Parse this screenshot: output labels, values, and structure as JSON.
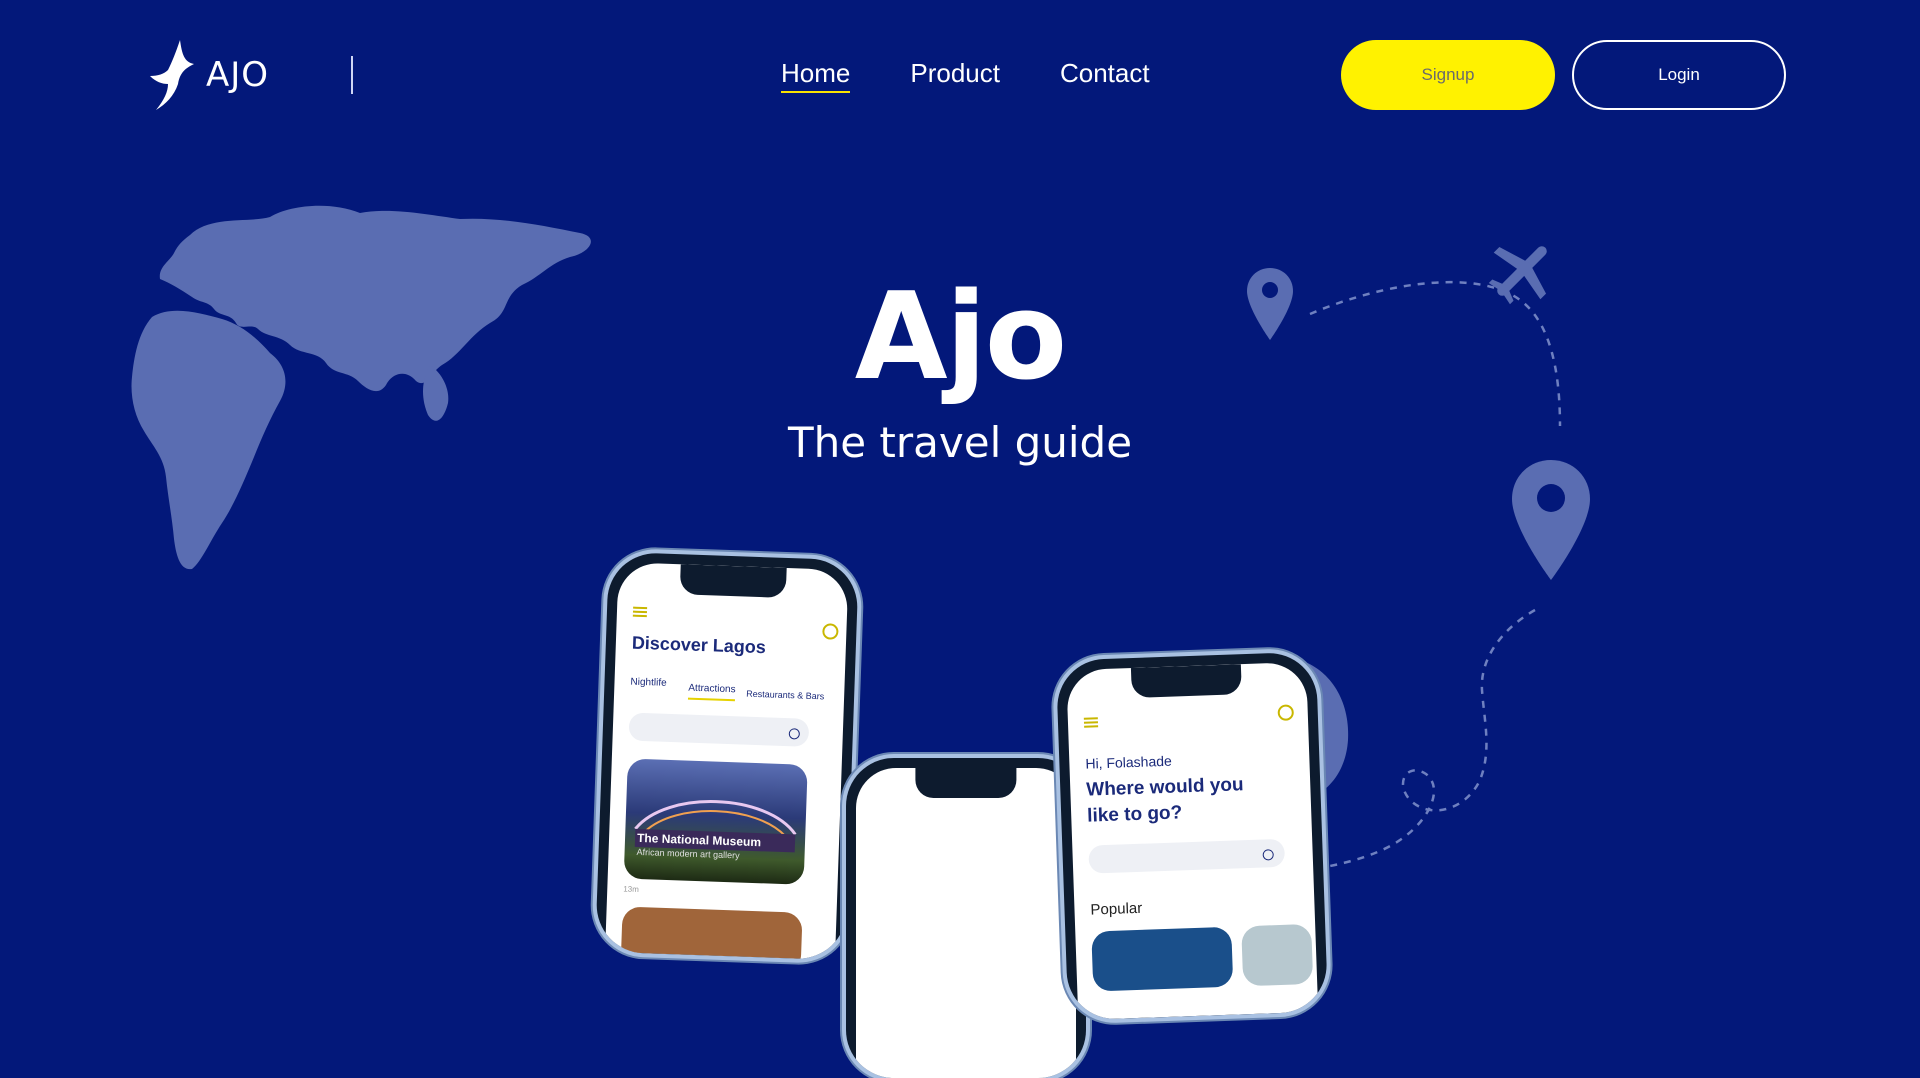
{
  "brand": {
    "name": "AJO"
  },
  "nav": {
    "home": "Home",
    "product": "Product",
    "contact": "Contact"
  },
  "actions": {
    "signup": "Signup",
    "login": "Login"
  },
  "hero": {
    "title": "Ajo",
    "subtitle": "The travel guide"
  },
  "phone_left": {
    "heading": "Discover Lagos",
    "tabs": [
      "Nightlife",
      "Attractions",
      "Restaurants & Bars"
    ],
    "card_title": "The National Museum",
    "card_subtitle": "African modern art gallery",
    "card_meta": "13m"
  },
  "phone_right": {
    "greeting": "Hi, Folashade",
    "question": "Where would you like to go?",
    "section": "Popular"
  },
  "colors": {
    "background": "#03187a",
    "accent": "#fff200",
    "decor": "#5a6db2"
  }
}
